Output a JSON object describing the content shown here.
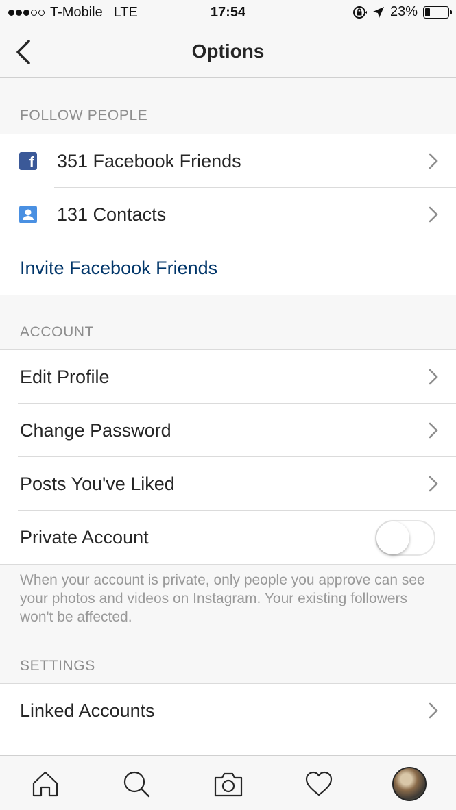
{
  "status_bar": {
    "carrier": "T-Mobile",
    "network": "LTE",
    "time": "17:54",
    "battery": "23%",
    "battery_level": 0.23,
    "signal_bars": 3,
    "icons": [
      "rotation-lock-icon",
      "location-arrow-icon",
      "battery-icon"
    ]
  },
  "nav": {
    "title": "Options",
    "back_icon": "chevron-left-icon"
  },
  "sections": {
    "follow_people": {
      "header": "FOLLOW PEOPLE",
      "rows": [
        {
          "label": "351 Facebook Friends",
          "icon": "facebook-icon"
        },
        {
          "label": "131 Contacts",
          "icon": "contacts-icon"
        }
      ],
      "invite_label": "Invite Facebook Friends"
    },
    "account": {
      "header": "ACCOUNT",
      "rows": [
        {
          "label": "Edit Profile"
        },
        {
          "label": "Change Password"
        },
        {
          "label": "Posts You've Liked"
        },
        {
          "label": "Private Account",
          "toggle": false
        }
      ],
      "footnote": "When your account is private, only people you approve can see your photos and videos on Instagram. Your existing followers won't be affected."
    },
    "settings": {
      "header": "SETTINGS",
      "rows": [
        {
          "label": "Linked Accounts"
        }
      ]
    }
  },
  "tab_bar": {
    "tabs": [
      "home-icon",
      "search-icon",
      "camera-icon",
      "heart-icon",
      "profile-avatar"
    ]
  },
  "colors": {
    "link": "#003569",
    "facebook": "#3b5998",
    "contacts": "#4a90e2",
    "section_header": "#8e8e8e"
  }
}
